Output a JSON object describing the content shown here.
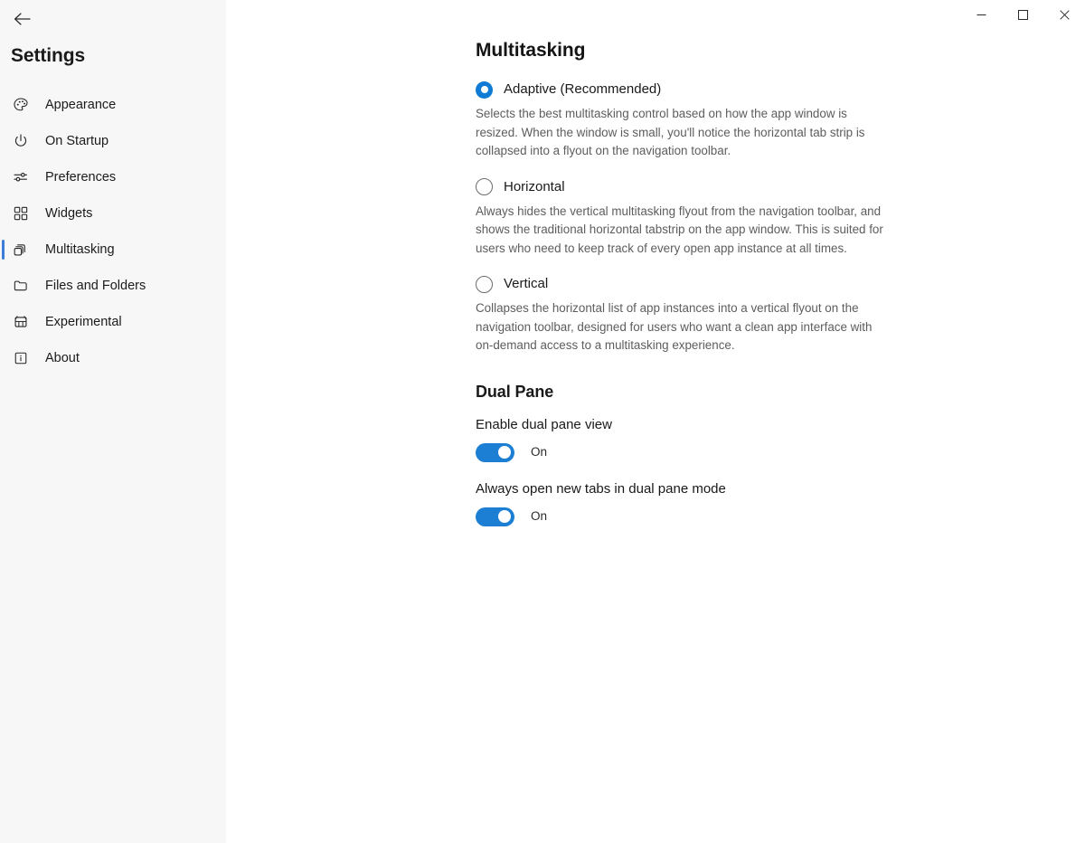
{
  "window": {
    "controls": [
      {
        "name": "minimize",
        "label": "Minimize",
        "glyph": "minimize-icon"
      },
      {
        "name": "maximize",
        "label": "Maximize",
        "glyph": "maximize-icon"
      },
      {
        "name": "close",
        "label": "Close",
        "glyph": "close-icon"
      }
    ]
  },
  "sidebar": {
    "back_label": "Back",
    "title": "Settings",
    "accent_color": "#3b7dd8",
    "background_color": "#f7f7f7",
    "items": [
      {
        "label": "Appearance",
        "icon": "palette-icon",
        "selected": false
      },
      {
        "label": "On Startup",
        "icon": "power-icon",
        "selected": false
      },
      {
        "label": "Preferences",
        "icon": "sliders-icon",
        "selected": false
      },
      {
        "label": "Widgets",
        "icon": "widgets-icon",
        "selected": false
      },
      {
        "label": "Multitasking",
        "icon": "copy-stack-icon",
        "selected": true
      },
      {
        "label": "Files and Folders",
        "icon": "folder-icon",
        "selected": false
      },
      {
        "label": "Experimental",
        "icon": "beaker-icon",
        "selected": false
      },
      {
        "label": "About",
        "icon": "info-box-icon",
        "selected": false
      }
    ]
  },
  "main": {
    "title": "Multitasking",
    "radio_group": {
      "name": "multitasking-mode",
      "selected_value": "adaptive",
      "accent_color": "#0f7bd4",
      "options": [
        {
          "value": "adaptive",
          "label": "Adaptive (Recommended)",
          "checked": true,
          "description": "Selects the best multitasking control based on how the app window is resized. When the window is small, you'll notice the horizontal tab strip is collapsed into a flyout on the navigation toolbar."
        },
        {
          "value": "horizontal",
          "label": "Horizontal",
          "checked": false,
          "description": "Always hides the vertical multitasking flyout from the navigation toolbar, and shows the traditional horizontal tabstrip on the app window. This is suited for users who need to keep track of every open app instance at all times."
        },
        {
          "value": "vertical",
          "label": "Vertical",
          "checked": false,
          "description": "Collapses the horizontal list of app instances into a vertical flyout on the navigation toolbar, designed for users who want a clean app interface with on-demand access to a multitasking experience."
        }
      ]
    },
    "dual_pane": {
      "section_title": "Dual Pane",
      "accent_color": "#1d7fd4",
      "settings": [
        {
          "label": "Enable dual pane view",
          "state_label": "On",
          "checked": true
        },
        {
          "label": "Always open new tabs in dual pane mode",
          "state_label": "On",
          "checked": true
        }
      ]
    }
  }
}
